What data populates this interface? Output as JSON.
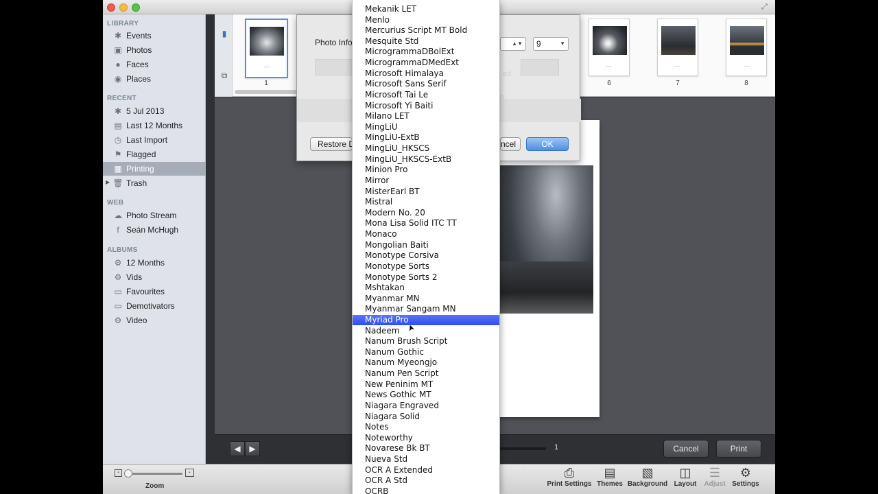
{
  "sidebar": {
    "sections": [
      {
        "heading": "LIBRARY",
        "items": [
          {
            "label": "Events",
            "icon": "palm-tree-icon"
          },
          {
            "label": "Photos",
            "icon": "photos-icon"
          },
          {
            "label": "Faces",
            "icon": "person-icon"
          },
          {
            "label": "Places",
            "icon": "globe-icon"
          }
        ]
      },
      {
        "heading": "RECENT",
        "items": [
          {
            "label": "5 Jul 2013",
            "icon": "palm-tree-icon"
          },
          {
            "label": "Last 12 Months",
            "icon": "calendar-icon"
          },
          {
            "label": "Last Import",
            "icon": "clock-icon"
          },
          {
            "label": "Flagged",
            "icon": "flag-icon"
          },
          {
            "label": "Printing",
            "icon": "print-project-icon"
          },
          {
            "label": "Trash",
            "icon": "trash-icon"
          }
        ]
      },
      {
        "heading": "WEB",
        "items": [
          {
            "label": "Photo Stream",
            "icon": "photo-stream-icon"
          },
          {
            "label": "Seán McHugh",
            "icon": "facebook-icon"
          }
        ]
      },
      {
        "heading": "ALBUMS",
        "items": [
          {
            "label": "12 Months",
            "icon": "smart-album-icon"
          },
          {
            "label": "Vids",
            "icon": "smart-album-icon"
          },
          {
            "label": "Favourites",
            "icon": "album-icon"
          },
          {
            "label": "Demotivators",
            "icon": "album-icon"
          },
          {
            "label": "Video",
            "icon": "smart-album-icon"
          }
        ]
      }
    ]
  },
  "thumbnails": [
    {
      "number": "1",
      "selected": true
    },
    {
      "number": "6"
    },
    {
      "number": "7"
    },
    {
      "number": "8"
    }
  ],
  "dialog": {
    "photo_info_label": "Photo Info",
    "size_value": "9",
    "restore_label": "Restore D",
    "cancel_label": "ncel",
    "ok_label": "OK",
    "ghost_texts": [
      "ed",
      "h"
    ]
  },
  "font_menu": {
    "items": [
      "Mekanik LET",
      "Menlo",
      "Mercurius Script MT Bold",
      "Mesquite Std",
      "MicrogrammaDBolExt",
      "MicrogrammaDMedExt",
      "Microsoft Himalaya",
      "Microsoft Sans Serif",
      "Microsoft Tai Le",
      "Microsoft Yi Baiti",
      "Milano LET",
      "MingLiU",
      "MingLiU-ExtB",
      "MingLiU_HKSCS",
      "MingLiU_HKSCS-ExtB",
      "Minion Pro",
      "Mirror",
      "MisterEarl BT",
      "Mistral",
      "Modern No. 20",
      "Mona Lisa Solid ITC TT",
      "Monaco",
      "Mongolian Baiti",
      "Monotype Corsiva",
      "Monotype Sorts",
      "Monotype Sorts 2",
      "Mshtakan",
      "Myanmar MN",
      "Myanmar Sangam MN",
      "Myriad Pro",
      "Nadeem",
      "Nanum Brush Script",
      "Nanum Gothic",
      "Nanum Myeongjo",
      "Nanum Pen Script",
      "New Peninim MT",
      "News Gothic MT",
      "Niagara Engraved",
      "Niagara Solid",
      "Notes",
      "Noteworthy",
      "Novarese Bk BT",
      "Nueva Std",
      "OCR A Extended",
      "OCR A Std",
      "OCRB"
    ],
    "highlighted": "Myriad Pro"
  },
  "bottom_bar": {
    "page_number": "1",
    "cancel_label": "Cancel",
    "print_label": "Print"
  },
  "toolbar": {
    "zoom_label": "Zoom",
    "buttons": [
      {
        "label": "Print Settings",
        "icon": "printer-icon"
      },
      {
        "label": "Themes",
        "icon": "themes-icon"
      },
      {
        "label": "Background",
        "icon": "background-icon"
      },
      {
        "label": "Layout",
        "icon": "layout-icon"
      },
      {
        "label": "Adjust",
        "icon": "adjust-icon",
        "disabled": true
      },
      {
        "label": "Settings",
        "icon": "gear-icon"
      }
    ]
  },
  "colors": {
    "selection_blue": "#3a56f0",
    "sidebar_bg": "#dfe3e9",
    "ok_button": "#4d8fe3"
  }
}
